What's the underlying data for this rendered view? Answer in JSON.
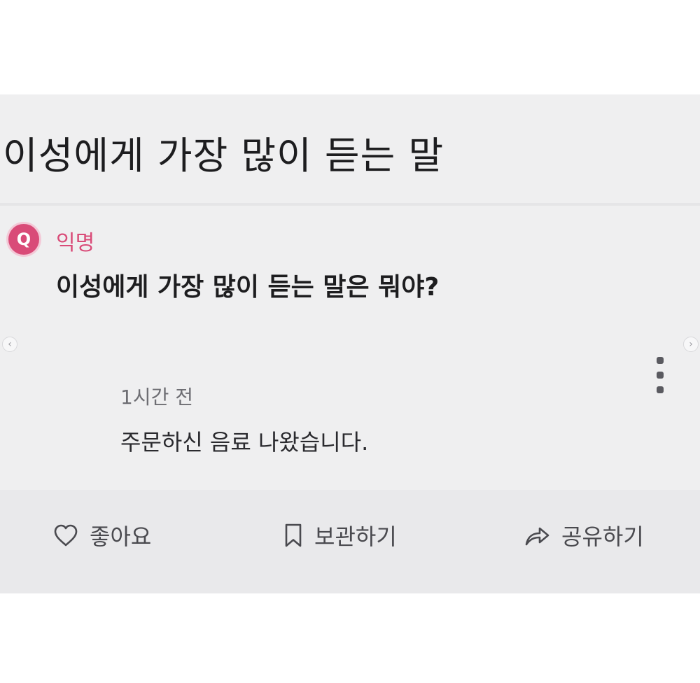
{
  "post": {
    "title": "이성에게 가장 많이 듣는 말",
    "author": "익명",
    "badge_letter": "Q",
    "question": "이성에게 가장 많이 듣는 말은 뭐야?"
  },
  "answer": {
    "time": "1시간 전",
    "text": "주문하신 음료 나왔습니다."
  },
  "actions": {
    "like_label": "좋아요",
    "save_label": "보관하기",
    "share_label": "공유하기"
  },
  "icons": {
    "like": "heart-icon",
    "save": "bookmark-icon",
    "share": "share-arrow-icon",
    "more": "more-vertical-icon",
    "prev": "chevron-left-icon",
    "next": "chevron-right-icon"
  },
  "colors": {
    "accent": "#d94b78",
    "card_bg": "#efeff0",
    "action_bg": "#e9e9eb",
    "text_primary": "#1d1d1f",
    "text_secondary": "#6e6e73"
  }
}
